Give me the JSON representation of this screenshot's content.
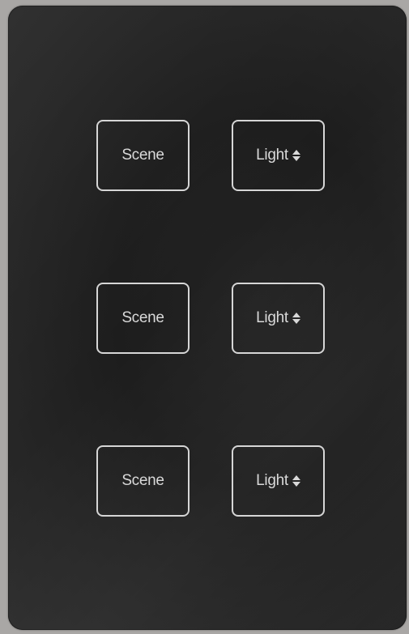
{
  "keypad": {
    "rows": [
      {
        "scene_label": "Scene",
        "light_label": "Light",
        "light_icon": "up-down-arrows-icon"
      },
      {
        "scene_label": "Scene",
        "light_label": "Light",
        "light_icon": "up-down-arrows-icon"
      },
      {
        "scene_label": "Scene",
        "light_label": "Light",
        "light_icon": "up-down-arrows-icon"
      }
    ],
    "colors": {
      "panel": "#1f1f1f",
      "button_border": "#d6d6d6",
      "text": "#d9d9d9",
      "background": "#a9a7a5"
    }
  }
}
